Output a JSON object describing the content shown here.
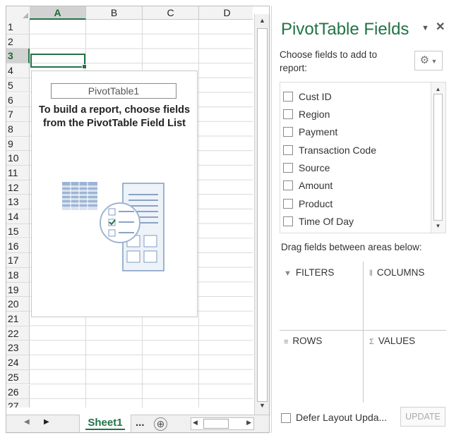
{
  "sheet": {
    "columns": [
      "A",
      "B",
      "C",
      "D"
    ],
    "rows": [
      "1",
      "2",
      "3",
      "4",
      "5",
      "6",
      "7",
      "8",
      "9",
      "10",
      "11",
      "12",
      "13",
      "14",
      "15",
      "16",
      "17",
      "18",
      "19",
      "20",
      "21",
      "22",
      "23",
      "24",
      "25",
      "26",
      "27"
    ],
    "selected_column": "A",
    "selected_row": "3"
  },
  "pivot": {
    "name": "PivotTable1",
    "message_line1": "To build a report, choose fields",
    "message_line2": "from the PivotTable Field List"
  },
  "tabs": {
    "active_sheet": "Sheet1",
    "more": "...",
    "add_symbol": "⊕"
  },
  "pane": {
    "title": "PivotTable Fields",
    "choose_text": "Choose fields to add to report:",
    "fields": [
      "Cust ID",
      "Region",
      "Payment",
      "Transaction Code",
      "Source",
      "Amount",
      "Product",
      "Time Of Day"
    ],
    "drag_text": "Drag fields between areas below:",
    "areas": {
      "filters": "FILTERS",
      "columns": "COLUMNS",
      "rows": "ROWS",
      "values": "VALUES"
    },
    "defer_label": "Defer Layout Upda...",
    "update_label": "UPDATE"
  },
  "colors": {
    "accent": "#217346"
  }
}
